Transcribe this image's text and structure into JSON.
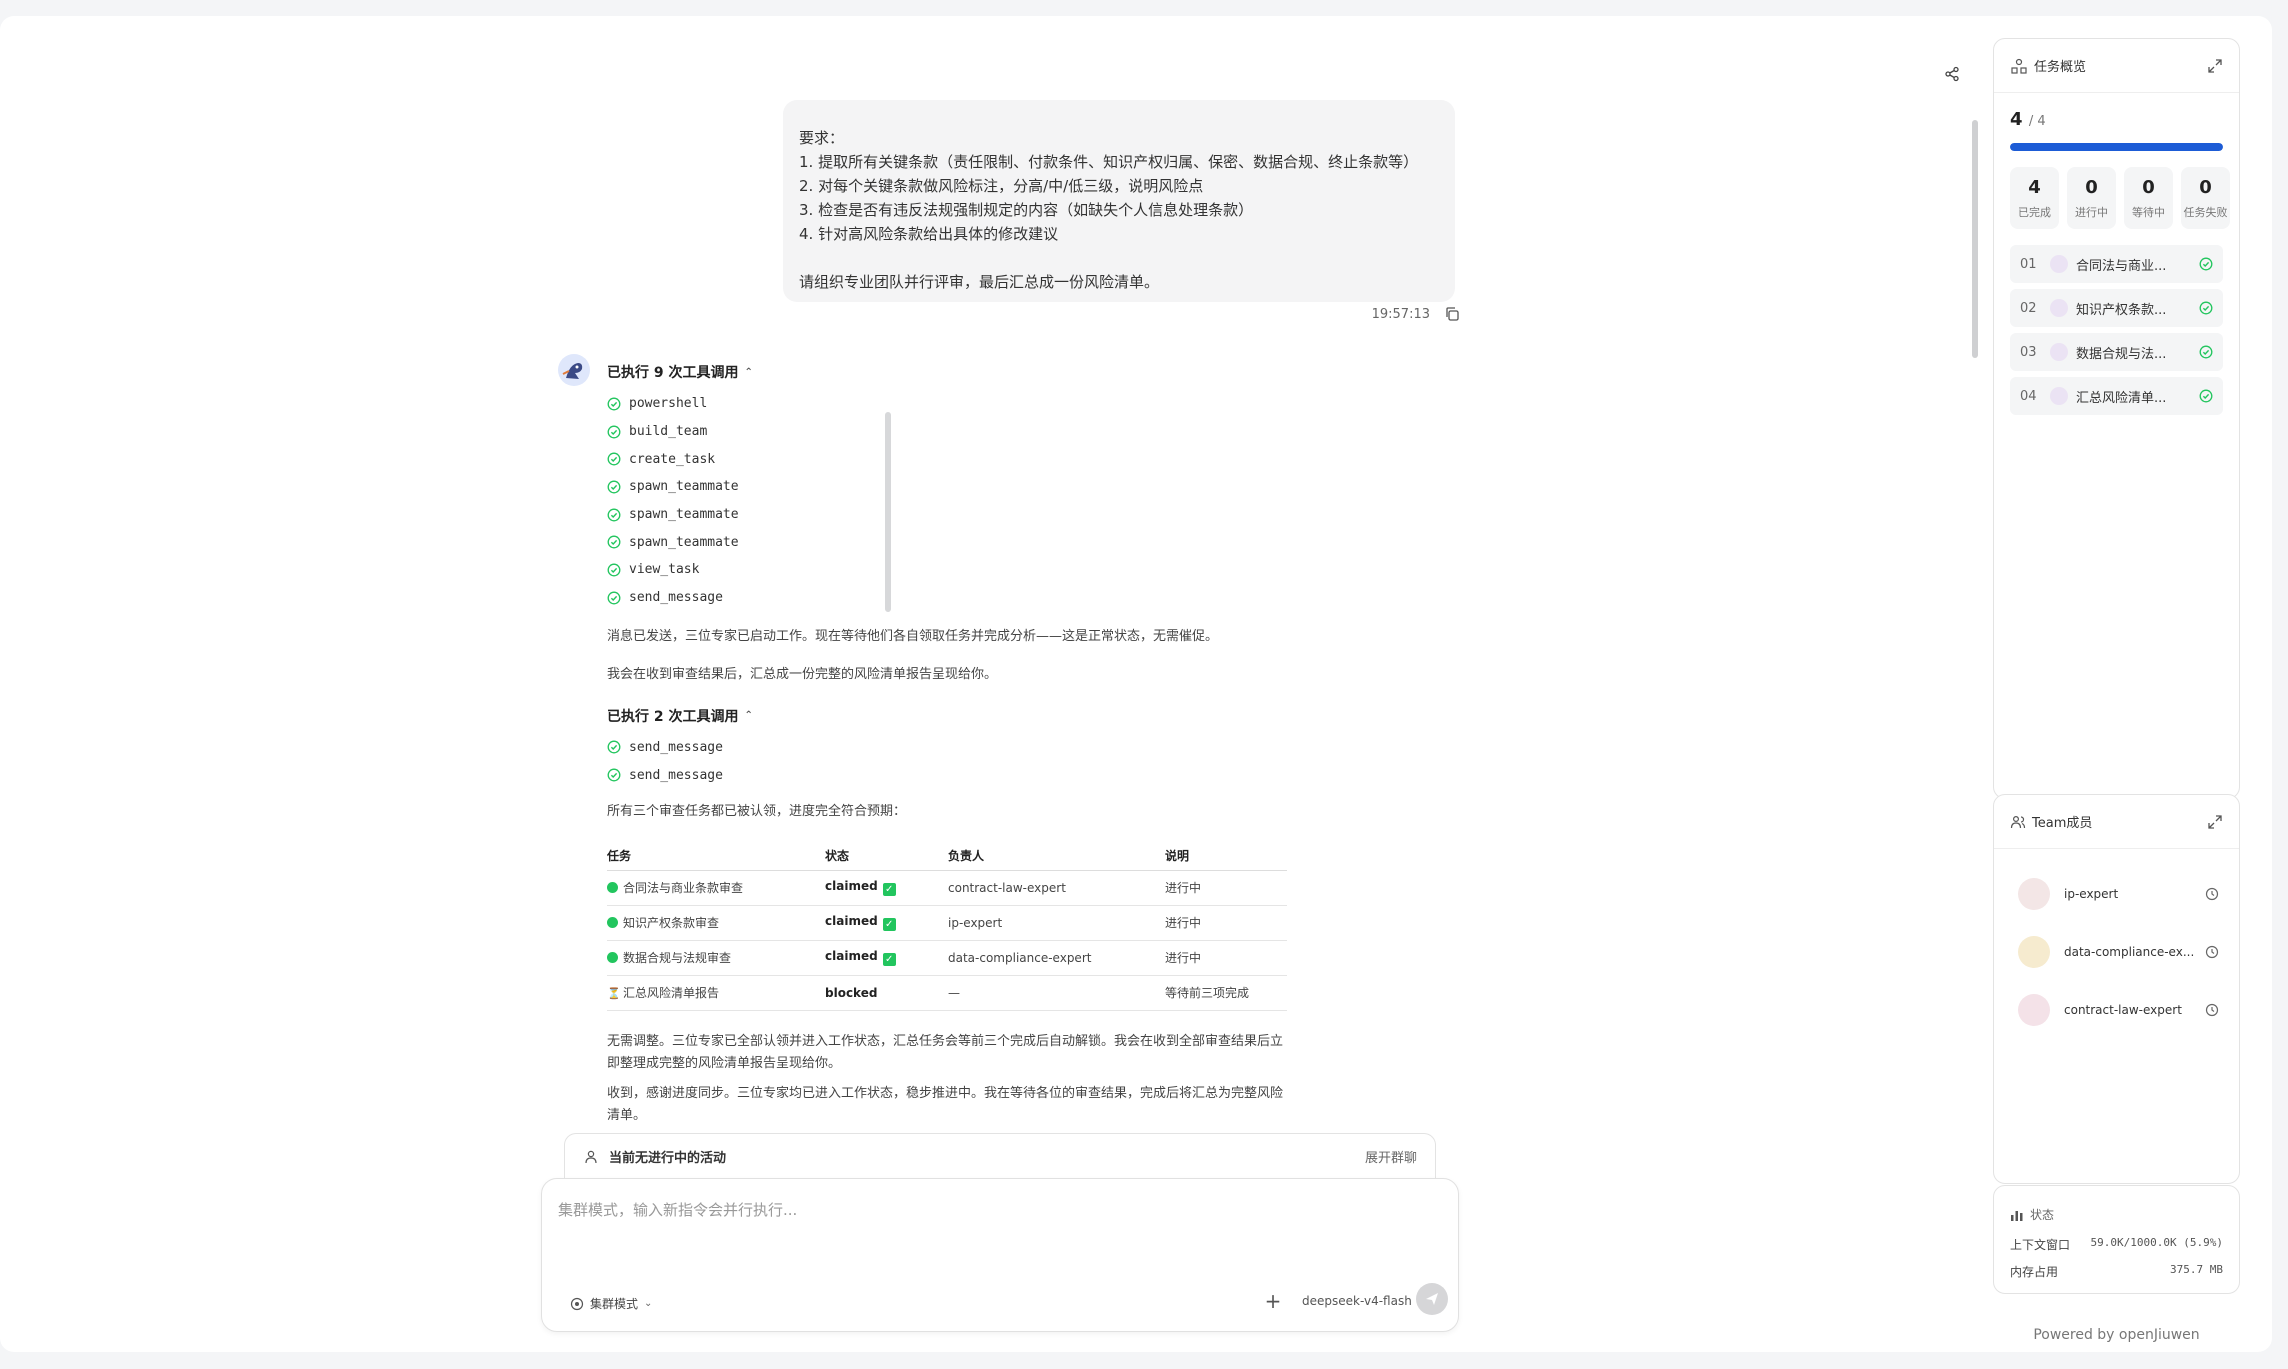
{
  "header": {
    "share_icon": "share-icon"
  },
  "chat": {
    "user_message": {
      "lines": [
        "要求：",
        "1. 提取所有关键条款（责任限制、付款条件、知识产权归属、保密、数据合规、终止条款等）",
        "2. 对每个关键条款做风险标注，分高/中/低三级，说明风险点",
        "3. 检查是否有违反法规强制规定的内容（如缺失个人信息处理条款）",
        "4. 针对高风险条款给出具体的修改建议",
        "",
        "请组织专业团队并行评审，最后汇总成一份风险清单。"
      ],
      "time": "19:57:13"
    },
    "tool_group_1": {
      "title": "已执行 9 次工具调用",
      "items": [
        "powershell",
        "build_team",
        "create_task",
        "spawn_teammate",
        "spawn_teammate",
        "spawn_teammate",
        "view_task",
        "send_message"
      ]
    },
    "para_1": "消息已发送，三位专家已启动工作。现在等待他们各自领取任务并完成分析——这是正常状态，无需催促。",
    "para_2": "我会在收到审查结果后，汇总成一份完整的风险清单报告呈现给你。",
    "tool_group_2": {
      "title": "已执行 2 次工具调用",
      "items": [
        "send_message",
        "send_message"
      ]
    },
    "para_3": "所有三个审查任务都已被认领，进度完全符合预期：",
    "table": {
      "headers": [
        "任务",
        "状态",
        "负责人",
        "说明"
      ],
      "rows": [
        {
          "task": "合同法与商业条款审查",
          "status": "claimed",
          "owner": "contract-law-expert",
          "note": "进行中"
        },
        {
          "task": "知识产权条款审查",
          "status": "claimed",
          "owner": "ip-expert",
          "note": "进行中"
        },
        {
          "task": "数据合规与法规审查",
          "status": "claimed",
          "owner": "data-compliance-expert",
          "note": "进行中"
        },
        {
          "task": "汇总风险清单报告",
          "status": "blocked",
          "owner": "—",
          "note": "等待前三项完成"
        }
      ]
    },
    "para_4": "无需调整。三位专家已全部认领并进入工作状态，汇总任务会等前三个完成后自动解锁。我会在收到全部审查结果后立即整理成完整的风险清单报告呈现给你。",
    "para_5": "收到，感谢进度同步。三位专家均已进入工作状态，稳步推进中。我在等待各位的审查结果，完成后将汇总为完整风险清单。"
  },
  "activity": {
    "text": "当前无进行中的活动",
    "expand": "展开群聊"
  },
  "input": {
    "placeholder": "集群模式，输入新指令会并行执行...",
    "mode": "集群模式",
    "model": "deepseek-v4-flash"
  },
  "task_panel": {
    "title": "任务概览",
    "done": "4",
    "total": "/ 4",
    "progress_fraction": 1.0,
    "stats": [
      {
        "num": "4",
        "label": "已完成"
      },
      {
        "num": "0",
        "label": "进行中"
      },
      {
        "num": "0",
        "label": "等待中"
      },
      {
        "num": "0",
        "label": "任务失败"
      }
    ],
    "tasks": [
      {
        "idx": "01",
        "name": "合同法与商业..."
      },
      {
        "idx": "02",
        "name": "知识产权条款..."
      },
      {
        "idx": "03",
        "name": "数据合规与法..."
      },
      {
        "idx": "04",
        "name": "汇总风险清单..."
      }
    ]
  },
  "team_panel": {
    "title": "Team成员",
    "members": [
      "ip-expert",
      "data-compliance-ex...",
      "contract-law-expert"
    ]
  },
  "status_panel": {
    "title": "状态",
    "context_label": "上下文窗口",
    "context_value": "59.0K/1000.0K (5.9%)",
    "memory_label": "内存占用",
    "memory_value": "375.7 MB"
  },
  "footer": {
    "powered": "Powered by openJiuwen"
  },
  "colors": {
    "accent": "#1d5cd6",
    "success": "#22c55e"
  }
}
